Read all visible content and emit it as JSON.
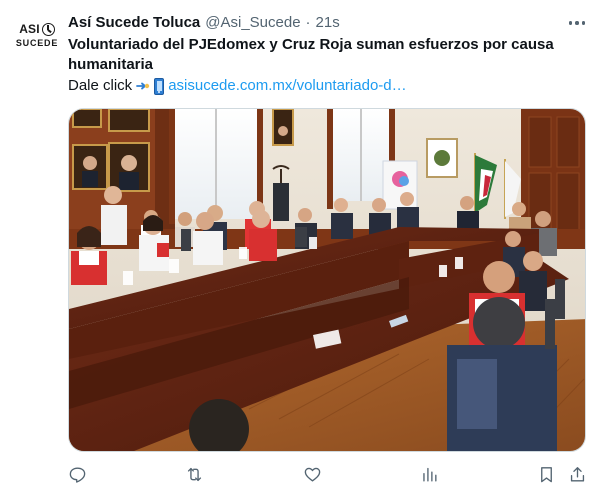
{
  "tweet": {
    "account": {
      "display_name": "Así Sucede Toluca",
      "handle": "@Asi_Sucede",
      "avatar_logo_line1": "ASI",
      "avatar_logo_line2": "SUCEDE"
    },
    "separator": "·",
    "time": "21s",
    "title": "Voluntariado del PJEdomex y Cruz Roja suman esfuerzos por causa humanitaria",
    "cta_text": "Dale click",
    "link_text": "asisucede.com.mx/voluntariado-d…",
    "media": {
      "kind": "photo",
      "scene": "meeting-room-volunteers"
    }
  },
  "colors": {
    "text_primary": "#0f1419",
    "text_secondary": "#536471",
    "link": "#1d9bf0",
    "media_border": "#cfd9de"
  },
  "icons": {
    "more": "more-dots-icon",
    "pointer": "pointing-hand-icon",
    "phone": "mobile-phone-icon",
    "reply": "reply-icon",
    "repost": "repost-icon",
    "like": "heart-icon",
    "views": "views-chart-icon",
    "bookmark": "bookmark-icon",
    "share": "share-icon"
  }
}
